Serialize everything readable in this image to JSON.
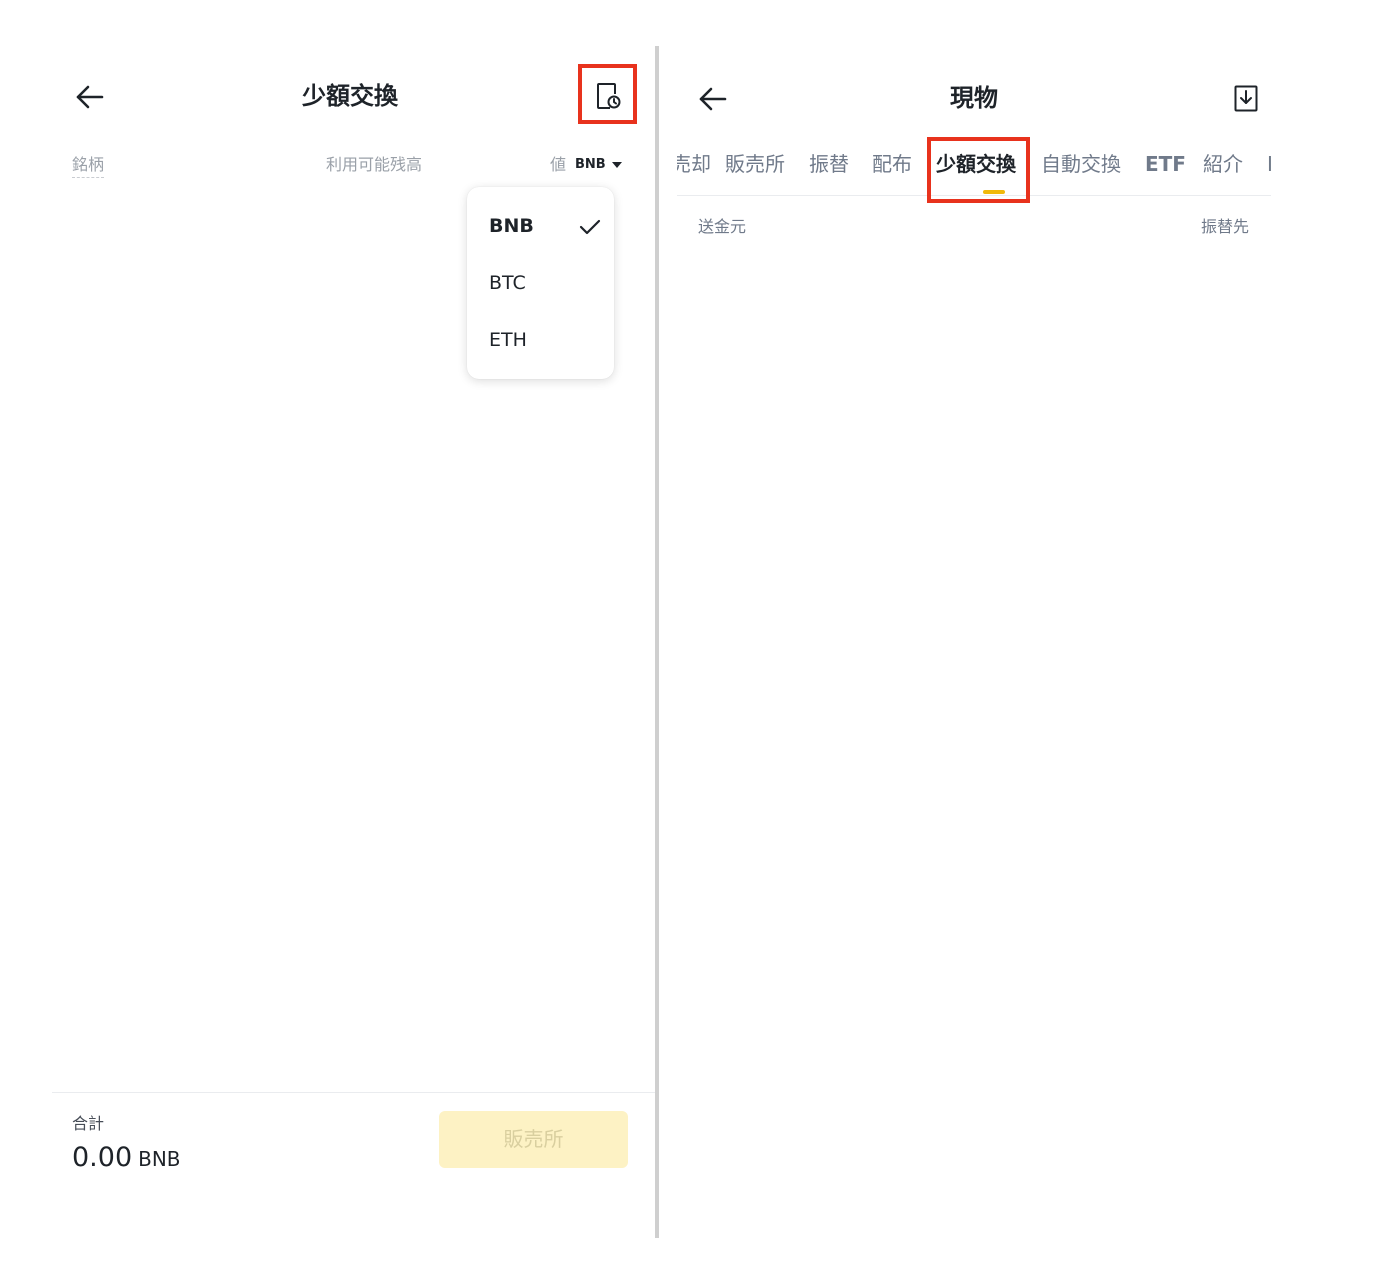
{
  "left": {
    "title": "少額交換",
    "columns": {
      "symbol": "銘柄",
      "available": "利用可能残高",
      "value": "値"
    },
    "value_unit": "BNB",
    "dropdown": {
      "options": [
        "BNB",
        "BTC",
        "ETH"
      ],
      "selected": "BNB"
    },
    "footer": {
      "total_label": "合計",
      "total_amount": "0.00",
      "total_unit": "BNB",
      "sell_label": "販売所"
    },
    "icons": {
      "back": "back-arrow-icon",
      "history": "history-icon",
      "check": "check-icon"
    }
  },
  "right": {
    "title": "現物",
    "tabs": [
      "売却",
      "販売所",
      "振替",
      "配布",
      "少額交換",
      "自動交換",
      "ETF",
      "紹介",
      "I"
    ],
    "active_tab": "少額交換",
    "columns": {
      "from": "送金元",
      "to": "振替先"
    },
    "icons": {
      "back": "back-arrow-icon",
      "export": "download-icon"
    }
  },
  "colors": {
    "accent": "#f0b90b",
    "highlight": "#e8321d",
    "text_primary": "#1e2329",
    "text_secondary": "#707a8a",
    "button_disabled_bg": "#fdf2c4"
  }
}
